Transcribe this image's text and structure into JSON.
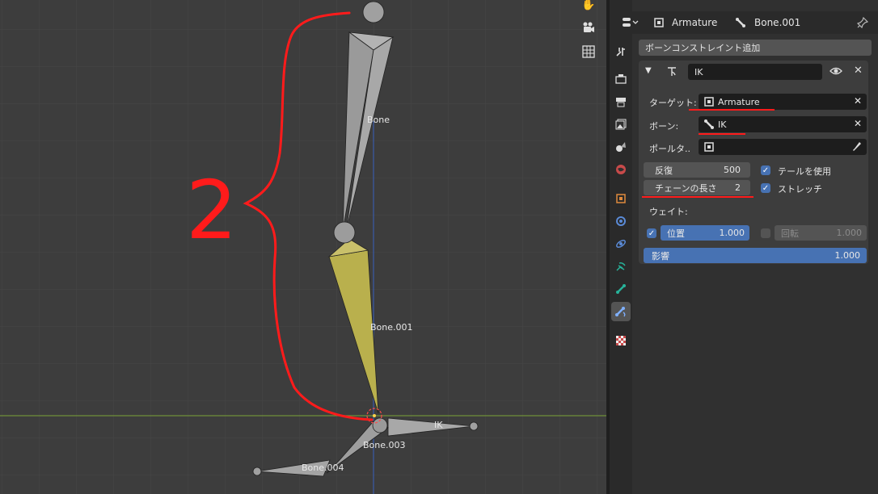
{
  "viewport": {
    "bones": [
      {
        "id": "bone",
        "label": "Bone"
      },
      {
        "id": "bone001",
        "label": "Bone.001"
      },
      {
        "id": "ik",
        "label": "IK"
      },
      {
        "id": "bone003",
        "label": "Bone.003"
      },
      {
        "id": "bone004",
        "label": "Bone.004"
      }
    ],
    "annotation_text": "2",
    "colors": {
      "grid": "#474747",
      "x_axis": "#6f8f3a",
      "z_axis": "#3a5ba8",
      "bone": "#a6a6a6",
      "selected_bone": "#b9b04d",
      "annotation": "#ff1b1b"
    },
    "nav_icons": [
      "hand-icon",
      "camera-icon",
      "grid-icon"
    ]
  },
  "props": {
    "header": {
      "object": "Armature",
      "bone": "Bone.001"
    },
    "add_constraint": "ボーンコンストレイント追加",
    "constraint": {
      "name": "IK",
      "target_label": "ターゲット:",
      "target_value": "Armature",
      "bone_label": "ボーン:",
      "bone_value": "IK",
      "pole_label": "ポールタ..",
      "iterations_label": "反復",
      "iterations_value": "500",
      "use_tail_label": "テールを使用",
      "chain_label": "チェーンの長さ",
      "chain_value": "2",
      "stretch_label": "ストレッチ",
      "weight_label": "ウェイト:",
      "position_label": "位置",
      "position_value": "1.000",
      "rotation_label": "回転",
      "rotation_value": "1.000",
      "influence_label": "影響",
      "influence_value": "1.000"
    },
    "tabs": [
      "tool-icon",
      "render-icon",
      "output-icon",
      "view-layer-icon",
      "scene-icon",
      "world-icon",
      "object-icon",
      "modifiers-icon",
      "physics-icon",
      "constraints-icon",
      "object-data-icon",
      "bone-icon",
      "bone-constraint-icon",
      "texture-icon"
    ]
  }
}
